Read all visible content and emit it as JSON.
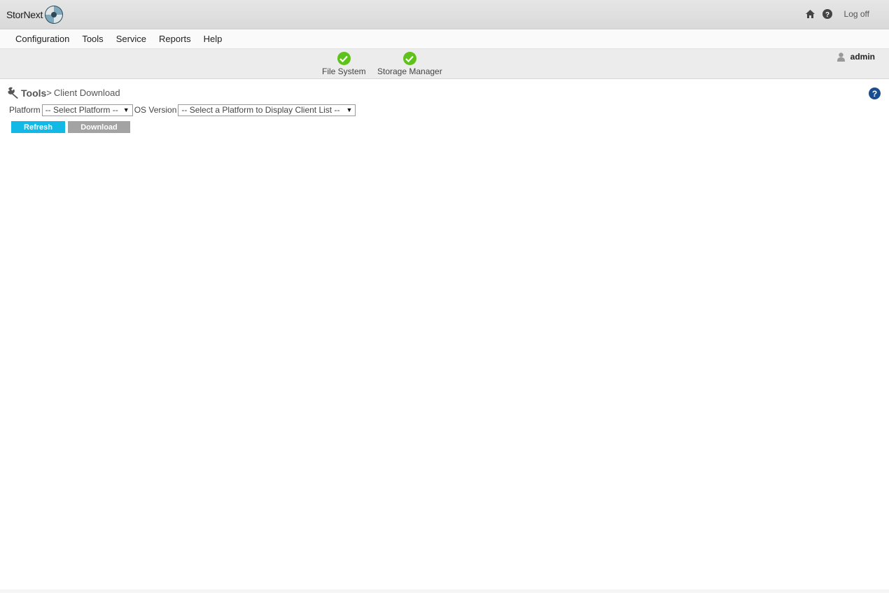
{
  "header": {
    "brand": "StorNext",
    "logoff_label": "Log off"
  },
  "menu": {
    "items": [
      "Configuration",
      "Tools",
      "Service",
      "Reports",
      "Help"
    ]
  },
  "status": {
    "items": [
      {
        "label": "File System",
        "state": "ok"
      },
      {
        "label": "Storage Manager",
        "state": "ok"
      }
    ],
    "user": "admin"
  },
  "breadcrumb": {
    "section": "Tools",
    "separator": ">",
    "page": "Client Download"
  },
  "form": {
    "platform_label": "Platform",
    "platform_value": "-- Select Platform --",
    "os_label": "OS Version",
    "os_value": "-- Select a Platform to Display Client List --"
  },
  "buttons": {
    "refresh": "Refresh",
    "download": "Download"
  },
  "colors": {
    "ok_green": "#5ec21b",
    "refresh_blue": "#12b8e6",
    "download_gray": "#a3a3a3",
    "help_blue": "#1a4d8f"
  }
}
